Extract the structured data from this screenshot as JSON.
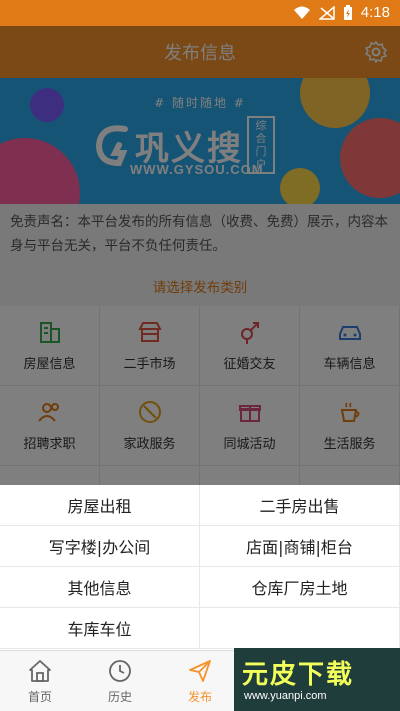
{
  "status_bar": {
    "time": "4:18"
  },
  "header": {
    "title": "发布信息"
  },
  "banner": {
    "tagline": "# 随时随地 #",
    "logo": "巩义搜",
    "logo_tag": "综合门户",
    "url": "WWW.GYSOU.COM"
  },
  "disclaimer": "免责声名：本平台发布的所有信息（收费、免费）展示，内容本身与平台无关，平台不负任何责任。",
  "prompt": "请选择发布类别",
  "categories": [
    {
      "label": "房屋信息",
      "icon": "building-icon",
      "color": "#3aa84a"
    },
    {
      "label": "二手市场",
      "icon": "shop-icon",
      "color": "#e0553f"
    },
    {
      "label": "征婚交友",
      "icon": "gender-icon",
      "color": "#d94c4c"
    },
    {
      "label": "车辆信息",
      "icon": "car-icon",
      "color": "#3b7bd8"
    },
    {
      "label": "招聘求职",
      "icon": "people-icon",
      "color": "#e07a16"
    },
    {
      "label": "家政服务",
      "icon": "broom-icon",
      "color": "#e0a016"
    },
    {
      "label": "同城活动",
      "icon": "gift-icon",
      "color": "#d94c7a"
    },
    {
      "label": "生活服务",
      "icon": "coffee-icon",
      "color": "#e07a16"
    }
  ],
  "popup_options": [
    "房屋出租",
    "二手房出售",
    "写字楼|办公间",
    "店面|商铺|柜台",
    "其他信息",
    "仓库厂房土地",
    "车库车位"
  ],
  "tabs": [
    {
      "label": "首页",
      "icon": "home-icon"
    },
    {
      "label": "历史",
      "icon": "clock-icon"
    },
    {
      "label": "发布",
      "icon": "send-icon"
    }
  ],
  "watermark": {
    "title": "元皮下载",
    "url": "www.yuanpi.com"
  }
}
